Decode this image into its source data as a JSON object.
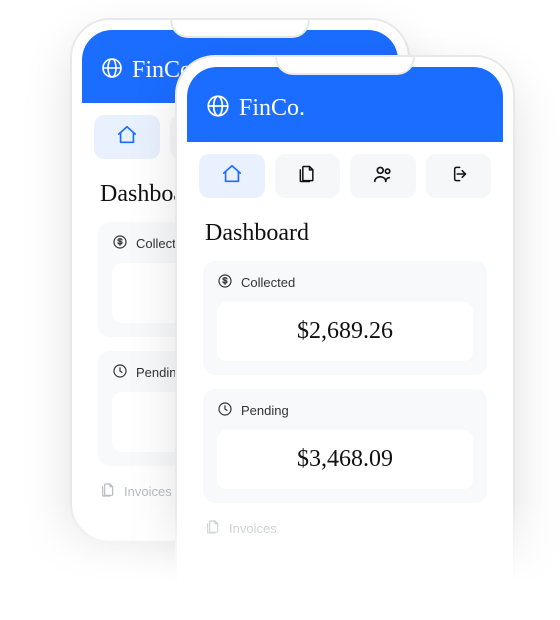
{
  "brand": "FinCo.",
  "page_title": "Dashboard",
  "nav": {
    "home": "home",
    "docs": "documents",
    "users": "users",
    "logout": "logout"
  },
  "cards": {
    "collected": {
      "label": "Collected",
      "value": "$2,689.26"
    },
    "pending": {
      "label": "Pending",
      "value": "$3,468.09"
    }
  },
  "invoices_label": "Invoices"
}
